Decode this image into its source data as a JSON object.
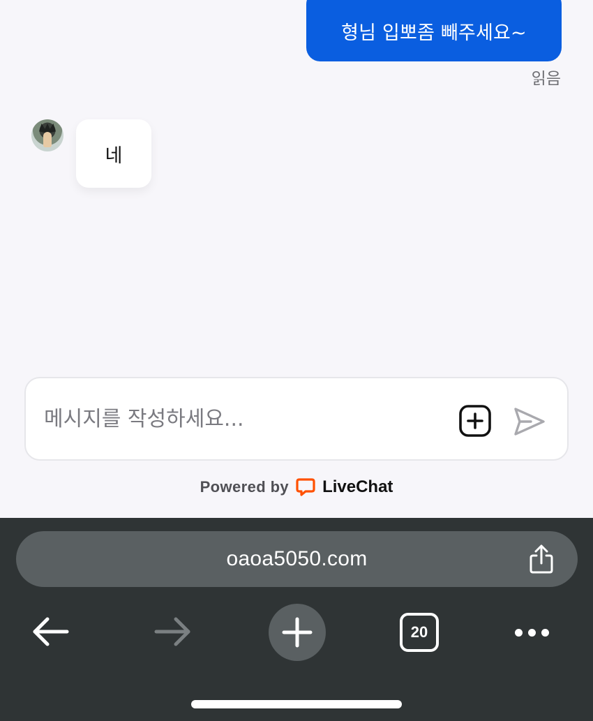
{
  "theme": {
    "chat_bg": "#f7f6fa",
    "outgoing_bubble_color": "#0a5ee0",
    "browser_bar_color": "#2f3435",
    "brand_orange": "#ff5100"
  },
  "messages": {
    "outgoing_text": "형님 입뽀좀 빼주세요~",
    "read_status": "읽음",
    "incoming_text": "네"
  },
  "composer": {
    "placeholder": "메시지를 작성하세요..."
  },
  "footer": {
    "powered_by": "Powered by",
    "brand": "LiveChat"
  },
  "browser": {
    "url": "oaoa5050.com",
    "tab_count": "20"
  },
  "icons": {
    "avatar": "avatar-image",
    "attach": "add-attachment-icon",
    "send": "send-icon",
    "logo": "livechat-logo-icon",
    "share": "share-icon",
    "back": "back-arrow-icon",
    "forward": "forward-arrow-icon",
    "new_tab": "plus-icon",
    "tabs": "tabs-icon",
    "more": "more-icon"
  }
}
